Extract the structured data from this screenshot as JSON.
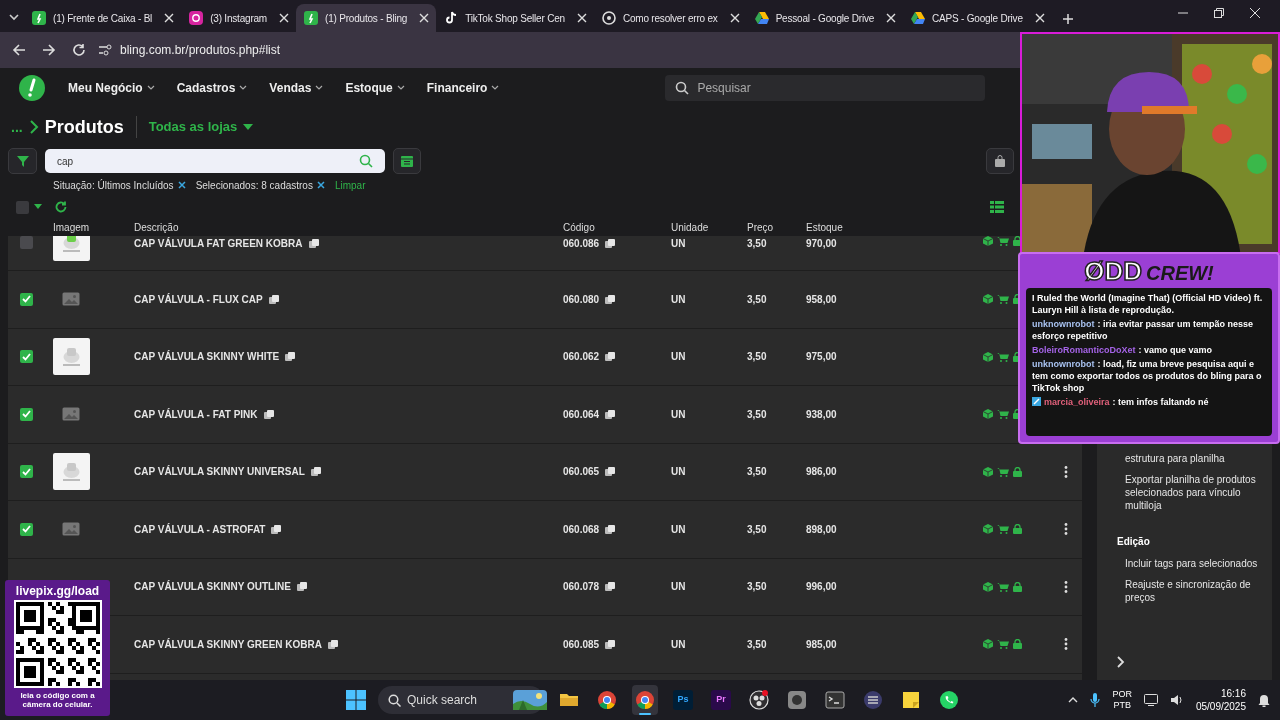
{
  "browser": {
    "tabs": [
      {
        "kind": "bling",
        "title": "(1) Frente de Caixa - Bl",
        "selected": false
      },
      {
        "kind": "instagram",
        "title": "(3) Instagram",
        "selected": false
      },
      {
        "kind": "bling",
        "title": "(1) Produtos - Bling",
        "selected": true
      },
      {
        "kind": "tiktok",
        "title": "TikTok Shop Seller Cen",
        "selected": false
      },
      {
        "kind": "chat",
        "title": "Como resolver erro ex",
        "selected": false
      },
      {
        "kind": "drive",
        "title": "Pessoal - Google Drive",
        "selected": false
      },
      {
        "kind": "drive",
        "title": "CAPS - Google Drive",
        "selected": false
      }
    ],
    "url": "bling.com.br/produtos.php#list"
  },
  "nav": {
    "menus": [
      "Meu Negócio",
      "Cadastros",
      "Vendas",
      "Estoque",
      "Financeiro"
    ],
    "search": {
      "placeholder": "Pesquisar"
    }
  },
  "page": {
    "select_all": {
      "checked": false
    },
    "breadcrumb": "...",
    "title": "Produtos",
    "store_filter": "Todas as lojas",
    "search": {
      "value": "cap"
    },
    "filters": [
      {
        "label": "Situação: Últimos Incluídos"
      },
      {
        "label": "Selecionados: 8 cadastros"
      }
    ],
    "clear": "Limpar"
  },
  "table": {
    "columns": [
      "Imagem",
      "Descrição",
      "Código",
      "Unidade",
      "Preço",
      "Estoque"
    ],
    "rows": [
      {
        "checked": false,
        "description": "CAP VÁLVULA FAT GREEN KOBRA",
        "code": "060.086",
        "unit": "UN",
        "price": "3,50",
        "stock": "970,00",
        "menu": false
      },
      {
        "checked": true,
        "kind": "placeholder",
        "description": "CAP VÁLVULA - FLUX CAP",
        "code": "060.080",
        "unit": "UN",
        "price": "3,50",
        "stock": "958,00",
        "menu": false
      },
      {
        "checked": true,
        "description": "CAP VÁLVULA SKINNY WHITE",
        "code": "060.062",
        "unit": "UN",
        "price": "3,50",
        "stock": "975,00",
        "menu": false
      },
      {
        "checked": true,
        "kind": "placeholder",
        "description": "CAP VÁLVULA - FAT PINK",
        "code": "060.064",
        "unit": "UN",
        "price": "3,50",
        "stock": "938,00",
        "menu": false
      },
      {
        "checked": true,
        "description": "CAP VÁLVULA SKINNY UNIVERSAL",
        "code": "060.065",
        "unit": "UN",
        "price": "3,50",
        "stock": "986,00",
        "menu": true
      },
      {
        "checked": true,
        "kind": "placeholder",
        "description": "CAP VÁLVULA - ASTROFAT",
        "code": "060.068",
        "unit": "UN",
        "price": "3,50",
        "stock": "898,00",
        "menu": true
      },
      {
        "description": "CAP VÁLVULA SKINNY OUTLINE",
        "code": "060.078",
        "unit": "UN",
        "price": "3,50",
        "stock": "996,00",
        "menu": true
      },
      {
        "description": "CAP VÁLVULA SKINNY GREEN KOBRA",
        "code": "060.085",
        "unit": "UN",
        "price": "3,50",
        "stock": "985,00",
        "menu": true
      }
    ]
  },
  "actions_panel": {
    "items": [
      {
        "kind": "item",
        "label": "estrutura para planilha"
      },
      {
        "kind": "item",
        "label": "Exportar planilha de produtos selecionados para vínculo multiloja"
      },
      {
        "kind": "heading",
        "label": "Edição"
      },
      {
        "kind": "item",
        "label": "Incluir tags para selecionados"
      },
      {
        "kind": "item",
        "label": "Reajuste e sincronização de preços"
      }
    ]
  },
  "chat_overlay": {
    "logo": [
      "ØDD",
      "CREW!"
    ],
    "messages": [
      {
        "text": "I Ruled the World (Imagine That) (Official HD Video) ft. Lauryn Hill à lista de reprodução."
      },
      {
        "user": "unknownrobot",
        "color": "#a8c2f0",
        "text": ": iria evitar passar um tempão nesse esforço repetitivo"
      },
      {
        "user": "BoleiroRomanticoDoXet",
        "color": "#a463e6",
        "text": ": vamo que vamo"
      },
      {
        "user": "unknownrobot",
        "color": "#a8c2f0",
        "text": ": load, fiz uma breve pesquisa aqui e tem como exportar todos os produtos do bling para o TikTok shop"
      },
      {
        "user": "marcia_oliveira",
        "color": "#e0607a",
        "badge": true,
        "text": ": tem infos faltando né"
      }
    ]
  },
  "qr_overlay": {
    "title": "livepix.gg/load",
    "caption": "leia o código com a câmera do celular."
  },
  "taskbar": {
    "search": {
      "placeholder": "Quick search"
    },
    "apps": [
      {
        "kind": "folder",
        "selected": false
      },
      {
        "kind": "chrome",
        "selected": false
      },
      {
        "kind": "chrome",
        "selected": true
      },
      {
        "kind": "ps",
        "label": "Ps",
        "selected": false
      },
      {
        "kind": "pr",
        "label": "Pr",
        "selected": false
      },
      {
        "kind": "obs",
        "selected": false
      },
      {
        "kind": "disc",
        "selected": false
      },
      {
        "kind": "terminal",
        "selected": false
      },
      {
        "kind": "keypad",
        "selected": false
      },
      {
        "kind": "notes",
        "selected": false
      },
      {
        "kind": "whatsapp",
        "selected": false
      }
    ],
    "language": [
      "POR",
      "PTB"
    ],
    "time": "16:16",
    "date": "05/09/2025"
  }
}
